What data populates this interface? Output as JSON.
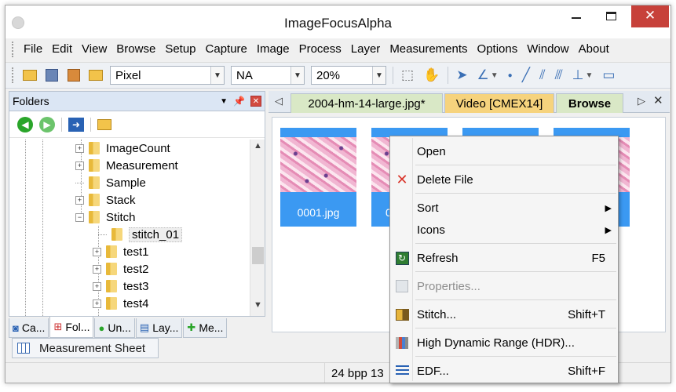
{
  "window": {
    "title": "ImageFocusAlpha"
  },
  "menu": [
    "File",
    "Edit",
    "View",
    "Browse",
    "Setup",
    "Capture",
    "Image",
    "Process",
    "Layer",
    "Measurements",
    "Options",
    "Window",
    "About"
  ],
  "toolbar": {
    "unit_combo": "Pixel",
    "na_combo": "NA",
    "zoom_combo": "20%"
  },
  "folders_pane": {
    "title": "Folders",
    "tree": [
      {
        "label": "ImageCount",
        "depth": 1,
        "expander": "plus"
      },
      {
        "label": "Measurement",
        "depth": 1,
        "expander": "plus"
      },
      {
        "label": "Sample",
        "depth": 1,
        "expander": "none"
      },
      {
        "label": "Stack",
        "depth": 1,
        "expander": "plus"
      },
      {
        "label": "Stitch",
        "depth": 1,
        "expander": "minus"
      },
      {
        "label": "stitch_01",
        "depth": 2,
        "expander": "none",
        "selected": true
      },
      {
        "label": "test1",
        "depth": 2,
        "expander": "plus"
      },
      {
        "label": "test2",
        "depth": 2,
        "expander": "plus"
      },
      {
        "label": "test3",
        "depth": 2,
        "expander": "plus"
      },
      {
        "label": "test4",
        "depth": 2,
        "expander": "plus"
      }
    ],
    "bottom_tabs": [
      "Ca...",
      "Fol...",
      "Un...",
      "Lay...",
      "Me..."
    ]
  },
  "measurement_sheet_tab": "Measurement Sheet",
  "doc_tabs": [
    "2004-hm-14-large.jpg*",
    "Video [CMEX14]",
    "Browse"
  ],
  "thumbnails": [
    "0001.jpg",
    "0"
  ],
  "status": {
    "bpp": "24 bpp  13"
  },
  "context_menu": {
    "open": "Open",
    "delete": "Delete File",
    "sort": "Sort",
    "icons": "Icons",
    "refresh": "Refresh",
    "refresh_shortcut": "F5",
    "properties": "Properties...",
    "stitch": "Stitch...",
    "stitch_shortcut": "Shift+T",
    "hdr": "High Dynamic Range (HDR)...",
    "edf": "EDF...",
    "edf_shortcut": "Shift+F"
  },
  "colors": {
    "close_button": "#c7413a",
    "thumb_selected": "#3b99f2",
    "tab_green": "#d9e8c6",
    "tab_orange": "#f6d37d"
  }
}
